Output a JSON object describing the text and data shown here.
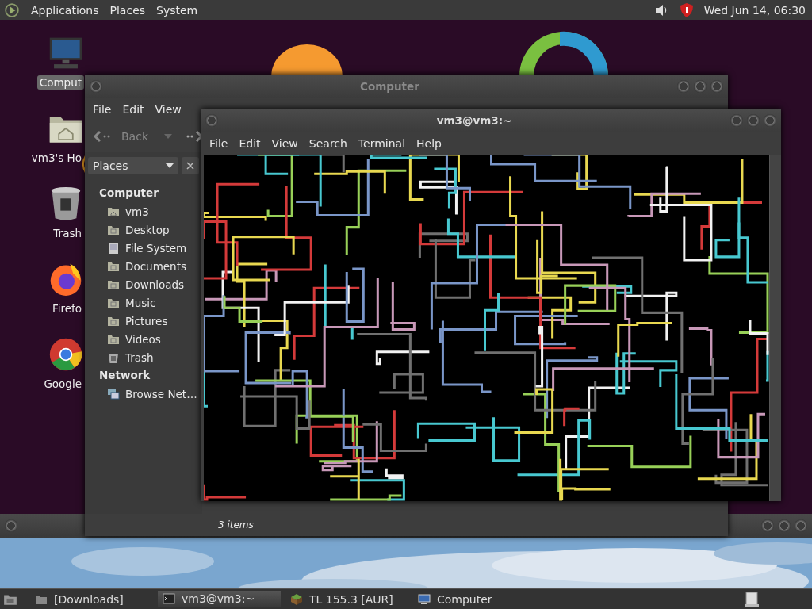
{
  "top_panel": {
    "menus": [
      "Applications",
      "Places",
      "System"
    ],
    "clock": "Wed Jun 14, 06:30"
  },
  "desktop_icons": [
    {
      "label": "Comput",
      "kind": "computer",
      "selected": true
    },
    {
      "label": "vm3's Ho",
      "kind": "home",
      "selected": false
    },
    {
      "label": "Trash",
      "kind": "trash",
      "selected": false
    },
    {
      "label": "Firefo",
      "kind": "fox",
      "selected": false
    },
    {
      "label": "Google",
      "kind": "chrome",
      "selected": false
    }
  ],
  "file_manager": {
    "title": "Computer",
    "menus": [
      "File",
      "Edit",
      "View"
    ],
    "back": "Back",
    "selector": "Places",
    "sections": [
      {
        "heading": "Computer",
        "items": [
          {
            "label": "vm3",
            "kind": "home"
          },
          {
            "label": "Desktop",
            "kind": "folder"
          },
          {
            "label": "File System",
            "kind": "drive"
          },
          {
            "label": "Documents",
            "kind": "folder"
          },
          {
            "label": "Downloads",
            "kind": "folder"
          },
          {
            "label": "Music",
            "kind": "folder"
          },
          {
            "label": "Pictures",
            "kind": "folder"
          },
          {
            "label": "Videos",
            "kind": "folder"
          },
          {
            "label": "Trash",
            "kind": "trash"
          }
        ]
      },
      {
        "heading": "Network",
        "items": [
          {
            "label": "Browse Net…",
            "kind": "network"
          }
        ]
      }
    ],
    "status": "3 items"
  },
  "terminal": {
    "title": "vm3@vm3:~",
    "menus": [
      "File",
      "Edit",
      "View",
      "Search",
      "Terminal",
      "Help"
    ]
  },
  "taskbar": {
    "items": [
      {
        "label": "[Downloads]",
        "kind": "folder",
        "selected": false
      },
      {
        "label": "vm3@vm3:~",
        "kind": "terminal",
        "selected": true
      },
      {
        "label": "TL 155.3 [AUR]",
        "kind": "block",
        "selected": false
      },
      {
        "label": "Computer",
        "kind": "computer",
        "selected": false
      }
    ]
  }
}
